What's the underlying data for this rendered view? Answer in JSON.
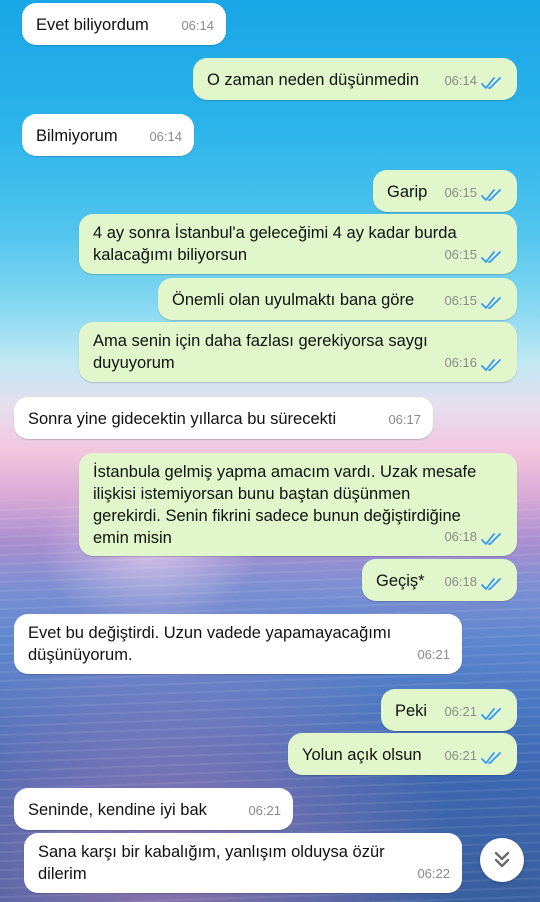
{
  "messages": [
    {
      "dir": "in",
      "text": "Evet biliyordum",
      "time": "06:14"
    },
    {
      "dir": "out",
      "text": "O zaman neden düşünmedin",
      "time": "06:14"
    },
    {
      "dir": "in",
      "text": "Bilmiyorum",
      "time": "06:14"
    },
    {
      "dir": "out",
      "text": "Garip",
      "time": "06:15"
    },
    {
      "dir": "out",
      "lines": [
        "4 ay sonra İstanbul'a geleceğimi 4 ay kadar burda",
        "kalacağımı biliyorsun"
      ],
      "time": "06:15"
    },
    {
      "dir": "out",
      "text": "Önemli olan uyulmaktı bana göre",
      "time": "06:15"
    },
    {
      "dir": "out",
      "lines": [
        "Ama senin için daha fazlası gerekiyorsa saygı",
        "duyuyorum"
      ],
      "time": "06:16"
    },
    {
      "dir": "in",
      "text": "Sonra yine gidecektin yıllarca bu sürecekti",
      "time": "06:17"
    },
    {
      "dir": "out",
      "lines": [
        "İstanbula gelmiş yapma amacım vardı. Uzak mesafe",
        "ilişkisi istemiyorsan bunu baştan düşünmen",
        "gerekirdi. Senin fikrini sadece bunun değiştirdiğine",
        "emin misin"
      ],
      "time": "06:18"
    },
    {
      "dir": "out",
      "text": "Geçiş*",
      "time": "06:18"
    },
    {
      "dir": "in",
      "lines": [
        "Evet bu değiştirdi. Uzun vadede yapamayacağımı",
        "düşünüyorum."
      ],
      "time": "06:21"
    },
    {
      "dir": "out",
      "text": "Peki",
      "time": "06:21"
    },
    {
      "dir": "out",
      "text": "Yolun açık olsun",
      "time": "06:21"
    },
    {
      "dir": "in",
      "text": "Seninde, kendine iyi bak",
      "time": "06:21"
    },
    {
      "dir": "in",
      "lines": [
        "Sana karşı bir kabalığım, yanlışım olduysa özür",
        "dilerim"
      ],
      "time": "06:22"
    }
  ],
  "colors": {
    "incoming_bubble": "#ffffff",
    "outgoing_bubble": "#e1f7cb",
    "read_ticks": "#3497f9",
    "timestamp": "#8a8a8a"
  },
  "icons": {
    "read_receipt": "double-check-icon",
    "scroll_down": "double-chevron-down-icon"
  }
}
